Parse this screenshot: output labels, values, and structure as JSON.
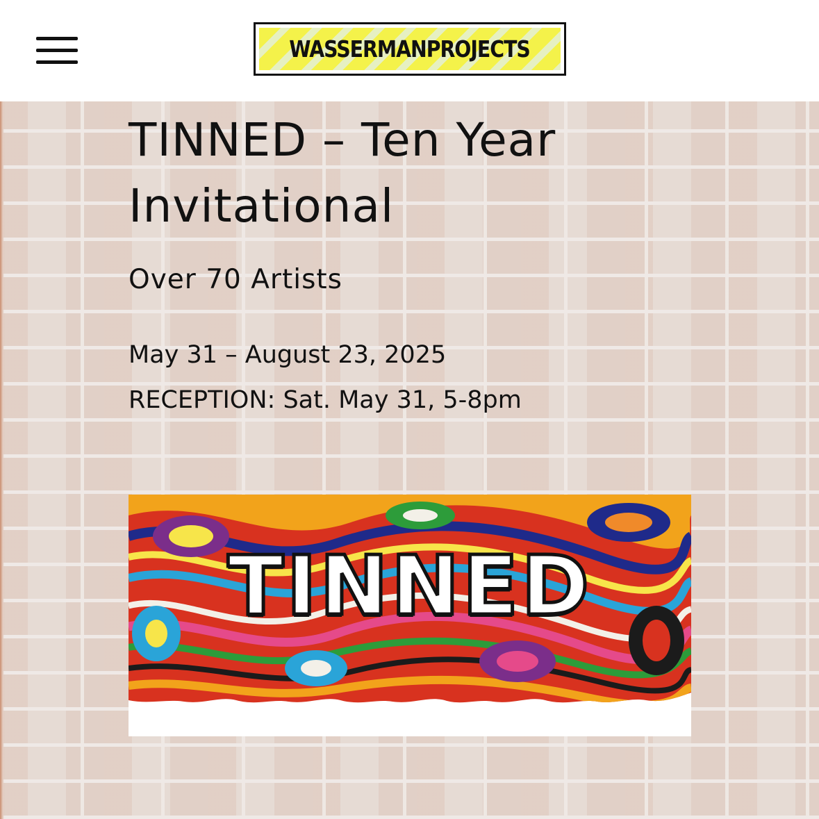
{
  "header": {
    "menu_icon": "hamburger-menu-icon",
    "logo_text": "WASSERMANPROJECTS"
  },
  "exhibition": {
    "title": "TINNED – Ten Year Invitational",
    "subtitle": "Over 70 Artists",
    "dates": "May 31 – August 23, 2025",
    "reception": "RECEPTION: Sat. May 31, 5-8pm"
  },
  "banner": {
    "word": "TINNED"
  },
  "colors": {
    "logo_yellow": "#f4f24a",
    "logo_stripe": "#e6f0c2",
    "text": "#111111",
    "wall": "#e6dcd6"
  }
}
